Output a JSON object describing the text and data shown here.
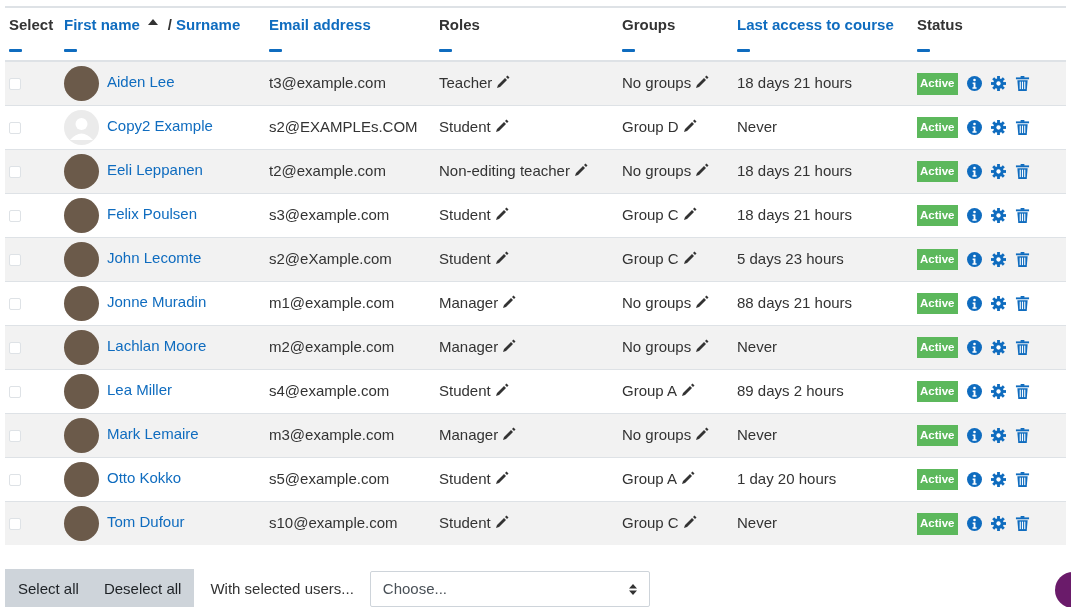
{
  "columns": [
    {
      "kind": "plain",
      "label": "Select"
    },
    {
      "kind": "name",
      "first": "First name",
      "sorted_ascending": true,
      "separator": "/",
      "second": "Surname"
    },
    {
      "kind": "link",
      "label": "Email address"
    },
    {
      "kind": "plain",
      "label": "Roles"
    },
    {
      "kind": "plain",
      "label": "Groups"
    },
    {
      "kind": "link",
      "label": "Last access to course"
    },
    {
      "kind": "plain",
      "label": "Status"
    }
  ],
  "rows": [
    {
      "checked": false,
      "has_photo": true,
      "name": "Aiden Lee",
      "email": "t3@example.com",
      "role": "Teacher",
      "group": "No groups",
      "last_access": "18 days 21 hours",
      "status": "Active"
    },
    {
      "checked": false,
      "has_photo": false,
      "name": "Copy2 Example",
      "email": "s2@EXAMPLEs.COM",
      "role": "Student",
      "group": "Group D",
      "last_access": "Never",
      "status": "Active"
    },
    {
      "checked": false,
      "has_photo": true,
      "name": "Eeli Leppanen",
      "email": "t2@example.com",
      "role": "Non-editing teacher",
      "group": "No groups",
      "last_access": "18 days 21 hours",
      "status": "Active"
    },
    {
      "checked": false,
      "has_photo": true,
      "name": "Felix Poulsen",
      "email": "s3@example.com",
      "role": "Student",
      "group": "Group C",
      "last_access": "18 days 21 hours",
      "status": "Active"
    },
    {
      "checked": false,
      "has_photo": true,
      "name": "John Lecomte",
      "email": "s2@eXample.com",
      "role": "Student",
      "group": "Group C",
      "last_access": "5 days 23 hours",
      "status": "Active"
    },
    {
      "checked": false,
      "has_photo": true,
      "name": "Jonne Muradin",
      "email": "m1@example.com",
      "role": "Manager",
      "group": "No groups",
      "last_access": "88 days 21 hours",
      "status": "Active"
    },
    {
      "checked": false,
      "has_photo": true,
      "name": "Lachlan Moore",
      "email": "m2@example.com",
      "role": "Manager",
      "group": "No groups",
      "last_access": "Never",
      "status": "Active"
    },
    {
      "checked": false,
      "has_photo": true,
      "name": "Lea Miller",
      "email": "s4@example.com",
      "role": "Student",
      "group": "Group A",
      "last_access": "89 days 2 hours",
      "status": "Active"
    },
    {
      "checked": false,
      "has_photo": true,
      "name": "Mark Lemaire",
      "email": "m3@example.com",
      "role": "Manager",
      "group": "No groups",
      "last_access": "Never",
      "status": "Active"
    },
    {
      "checked": false,
      "has_photo": true,
      "name": "Otto Kokko",
      "email": "s5@example.com",
      "role": "Student",
      "group": "Group A",
      "last_access": "1 day 20 hours",
      "status": "Active"
    },
    {
      "checked": false,
      "has_photo": true,
      "name": "Tom Dufour",
      "email": "s10@example.com",
      "role": "Student",
      "group": "Group C",
      "last_access": "Never",
      "status": "Active"
    }
  ],
  "footer": {
    "select_all": "Select all",
    "deselect_all": "Deselect all",
    "label": "With selected users...",
    "select": "Choose..."
  }
}
